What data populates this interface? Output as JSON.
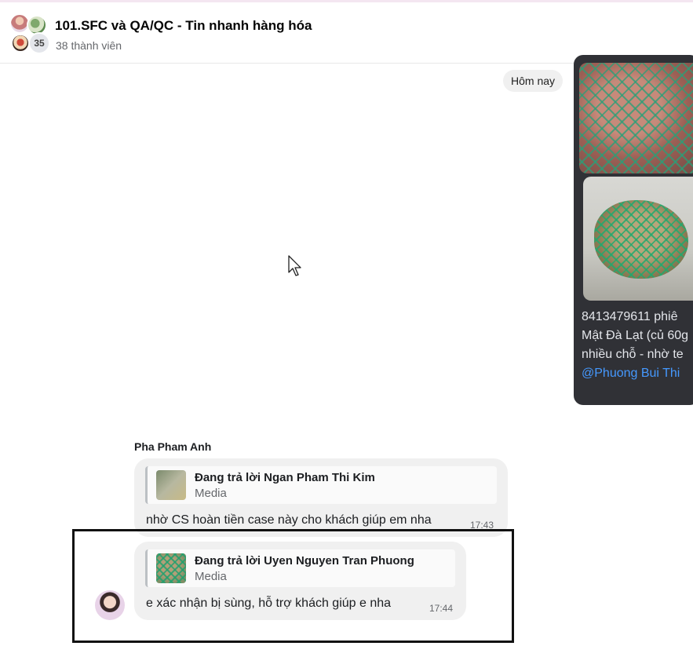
{
  "header": {
    "title": "101.SFC và QA/QC - Tin nhanh hàng hóa",
    "subtitle": "38 thành viên",
    "avatar_count": "35"
  },
  "date_separator": "Hôm nay",
  "media_message": {
    "lines": [
      "8413479611 phiê",
      "Mật Đà Lạt (củ 60g",
      "nhiều chỗ - nhờ te"
    ],
    "mention": "@Phuong Bui Thi"
  },
  "messages": [
    {
      "sender": "Pha Pham Anh",
      "reply_to": "Đang trả lời Ngan Pham Thi Kim",
      "reply_type": "Media",
      "text": "nhờ CS hoàn tiền case này cho khách giúp em nha",
      "time": "17:43"
    },
    {
      "reply_to": "Đang trả lời Uyen Nguyen Tran Phuong",
      "reply_type": "Media",
      "text": "e xác nhận bị sùng, hỗ trợ khách giúp e nha",
      "time": "17:44"
    }
  ],
  "colors": {
    "bubble": "#f0f0f0",
    "media_card": "#303136",
    "mention": "#4599ff",
    "highlight_border": "#111111"
  }
}
